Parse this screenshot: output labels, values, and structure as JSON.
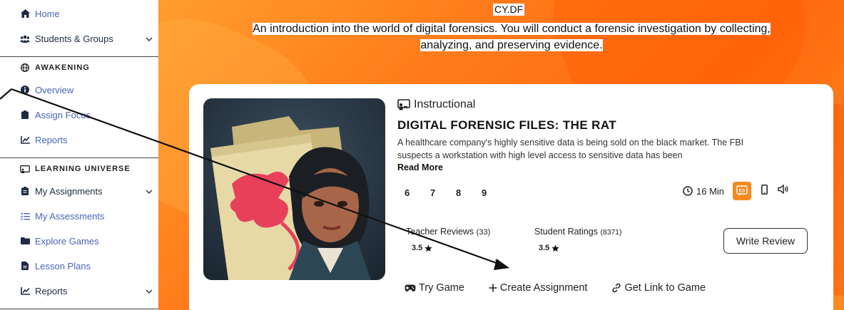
{
  "sidebar": {
    "home": "Home",
    "students_groups": "Students & Groups",
    "awakening_header": "AWAKENING",
    "overview": "Overview",
    "assign_focus": "Assign Focus",
    "reports_1": "Reports",
    "learning_universe_header": "LEARNING UNIVERSE",
    "my_assignments": "My Assignments",
    "my_assessments": "My Assessments",
    "explore_games": "Explore Games",
    "lesson_plans": "Lesson Plans",
    "reports_2": "Reports"
  },
  "hero": {
    "code": "CY.DF",
    "description_line1": "An introduction into the world of digital forensics. You will conduct a forensic investigation by collecting,",
    "description_line2": "analyzing, and preserving evidence."
  },
  "game": {
    "type": "Instructional",
    "title": "DIGITAL FORENSIC FILES: THE RAT",
    "description_line1": "A healthcare company's highly sensitive data is being sold on the black market. The FBI",
    "description_line2": "suspects a workstation with high level access to sensitive data has been",
    "read_more": "Read More",
    "grades": [
      "6",
      "7",
      "8",
      "9"
    ],
    "duration": "16 Min",
    "language_badge": "ES",
    "teacher_reviews_label": "Teacher Reviews",
    "teacher_reviews_count": "(33)",
    "teacher_rating": "3.5",
    "student_ratings_label": "Student Ratings",
    "student_ratings_count": "(8371)",
    "student_rating": "3.5",
    "write_review": "Write Review",
    "try_game": "Try Game",
    "create_assignment": "Create Assignment",
    "get_link": "Get Link to Game"
  },
  "colors": {
    "accent_orange": "#f6891f",
    "link_blue": "#4a63b8",
    "hero_orange": "#ff7a1a"
  }
}
